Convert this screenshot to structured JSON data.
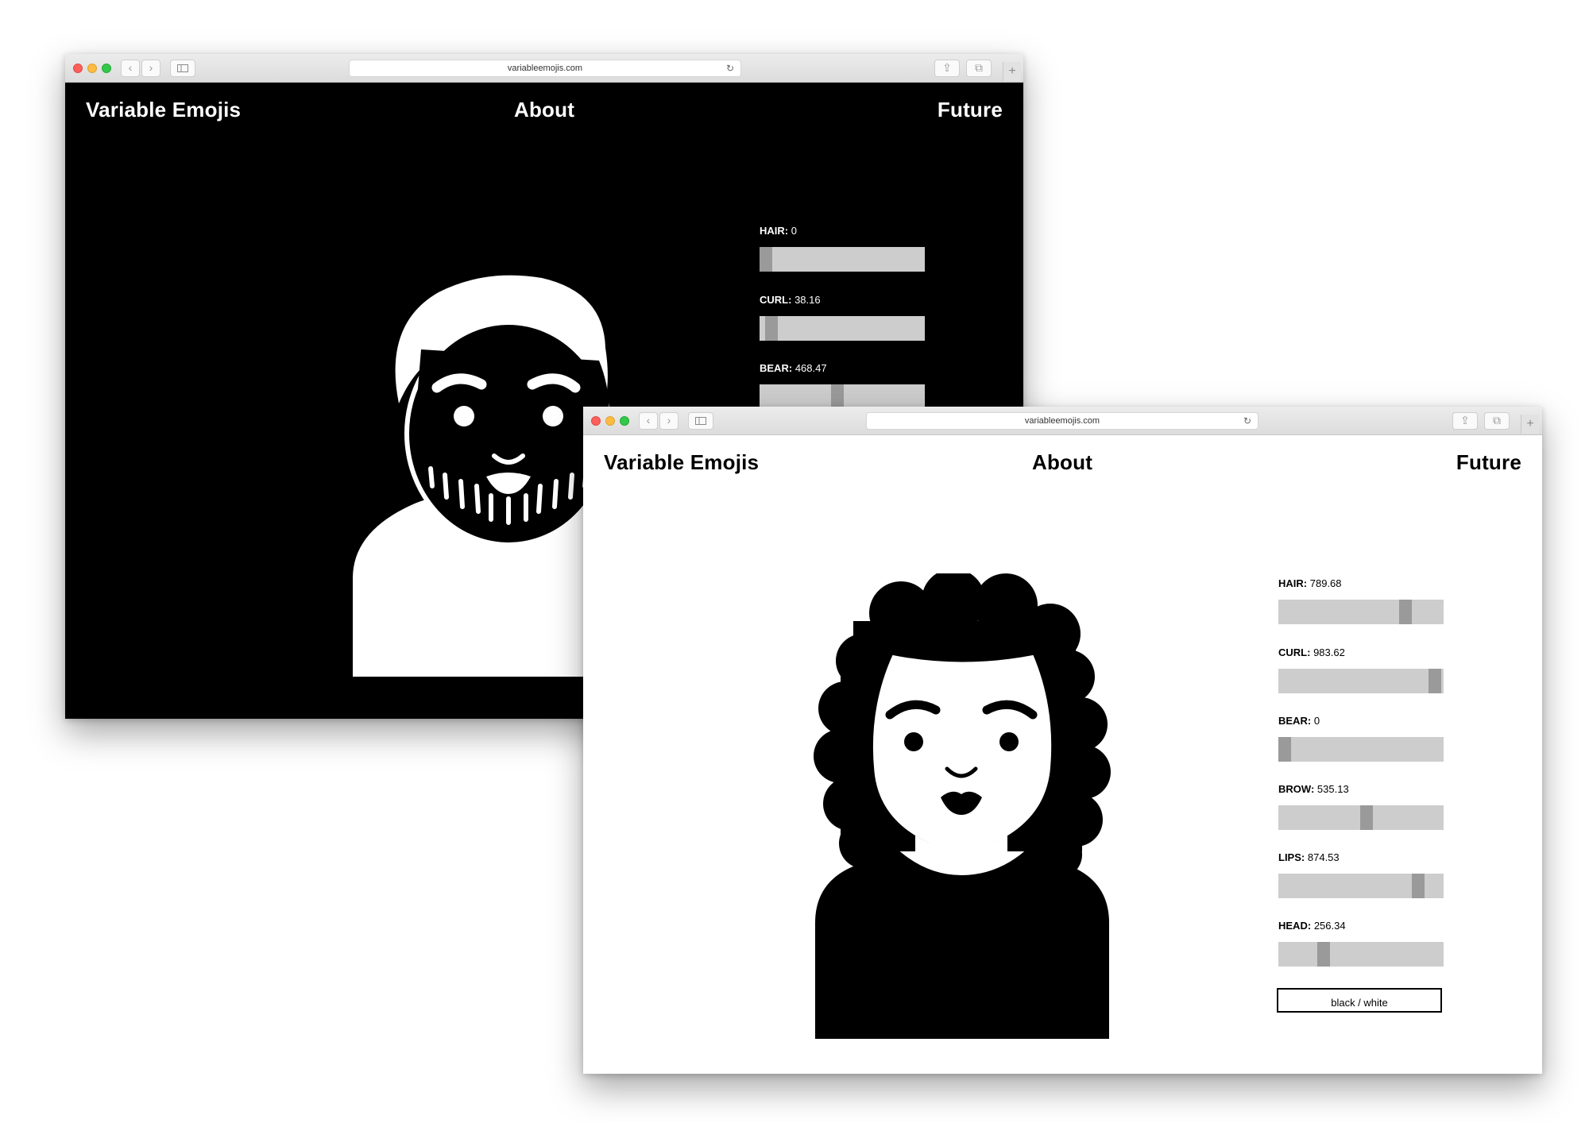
{
  "windows": [
    {
      "url": "variableemojis.com",
      "theme": "black",
      "nav": {
        "title": "Variable Emojis",
        "about": "About",
        "future": "Future"
      },
      "sliders": [
        {
          "name": "HAIR",
          "value": "0",
          "level": 0.0
        },
        {
          "name": "CURL",
          "value": "38.16",
          "level": 0.038
        },
        {
          "name": "BEAR",
          "value": "468.47",
          "level": 0.468
        }
      ]
    },
    {
      "url": "variableemojis.com",
      "theme": "white",
      "nav": {
        "title": "Variable Emojis",
        "about": "About",
        "future": "Future"
      },
      "sliders": [
        {
          "name": "HAIR",
          "value": "789.68",
          "level": 0.79
        },
        {
          "name": "CURL",
          "value": "983.62",
          "level": 0.984
        },
        {
          "name": "BEAR",
          "value": "0",
          "level": 0.0
        },
        {
          "name": "BROW",
          "value": "535.13",
          "level": 0.535
        },
        {
          "name": "LIPS",
          "value": "874.53",
          "level": 0.875
        },
        {
          "name": "HEAD",
          "value": "256.34",
          "level": 0.256
        }
      ],
      "toggle_label": "black / white"
    }
  ],
  "icons": [
    "back-arrow-icon",
    "forward-arrow-icon",
    "sidebar-icon",
    "reload-icon",
    "share-icon",
    "tabs-icon",
    "plus-icon"
  ],
  "colors": {
    "dark_bg": "#000000",
    "light_bg": "#ffffff",
    "track": "#cdcdcd",
    "thumb": "#9a9a9a"
  }
}
